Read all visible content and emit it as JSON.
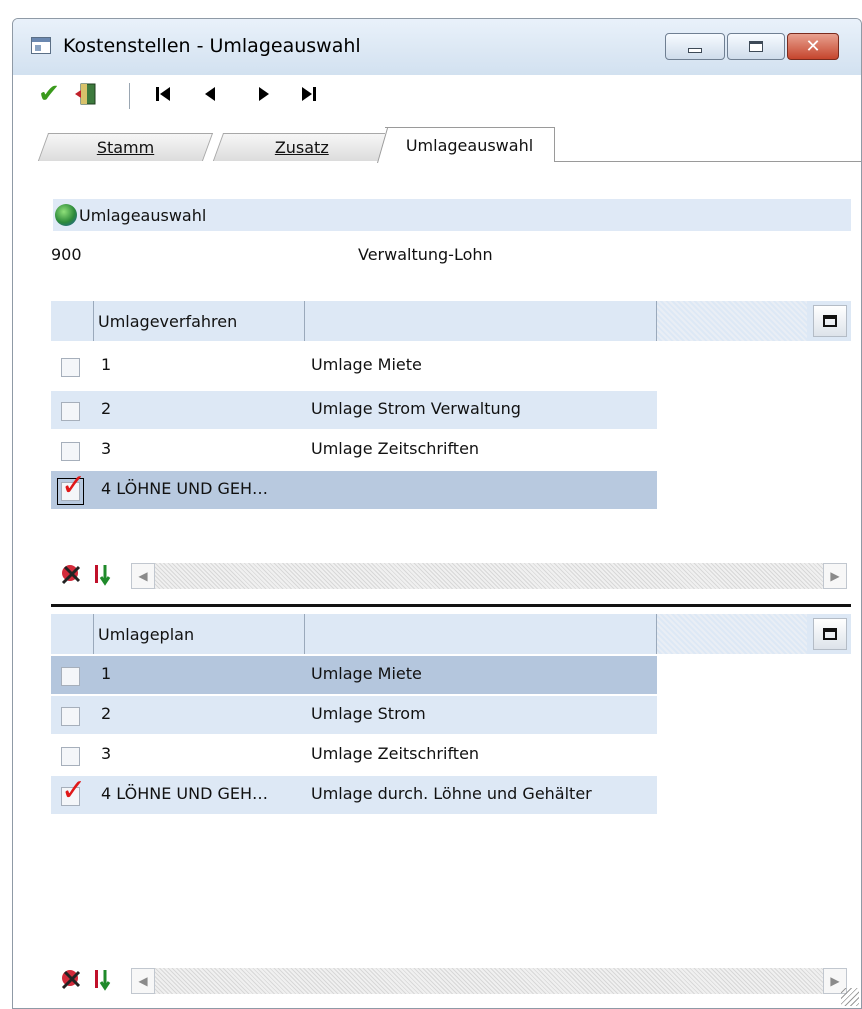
{
  "window": {
    "title": "Kostenstellen - Umlageauswahl"
  },
  "toolbar": {
    "ok_icon": "checkmark-icon",
    "exit_icon": "exit-door-icon",
    "first_icon": "first-record-icon",
    "prev_icon": "previous-record-icon",
    "next_icon": "next-record-icon",
    "last_icon": "last-record-icon"
  },
  "tabs": {
    "stamm": "Stamm",
    "zusatz": "Zusatz",
    "umlageauswahl": "Umlageauswahl"
  },
  "section": {
    "label": "Umlageauswahl",
    "nr": "900",
    "name": "Verwaltung-Lohn"
  },
  "verfahren": {
    "header": "Umlageverfahren",
    "rows": [
      {
        "nr": "1",
        "name": "Umlage Miete",
        "checked": false
      },
      {
        "nr": "2",
        "name": "Umlage Strom Verwaltung",
        "checked": false
      },
      {
        "nr": "3",
        "name": "Umlage Zeitschriften",
        "checked": false
      },
      {
        "nr": "4 LÖHNE UND GEH…",
        "name": "",
        "checked": true
      }
    ]
  },
  "plan": {
    "header": "Umlageplan",
    "rows": [
      {
        "nr": "1",
        "name": "Umlage Miete",
        "checked": false
      },
      {
        "nr": "2",
        "name": "Umlage Strom",
        "checked": false
      },
      {
        "nr": "3",
        "name": "Umlage Zeitschriften",
        "checked": false
      },
      {
        "nr": "4 LÖHNE UND GEH…",
        "name": "Umlage durch. Löhne und Gehälter",
        "checked": true
      }
    ]
  },
  "colors": {
    "row_alt": "#dde8f5",
    "row_selected": "#b8c9df",
    "check_red": "#e01818"
  }
}
